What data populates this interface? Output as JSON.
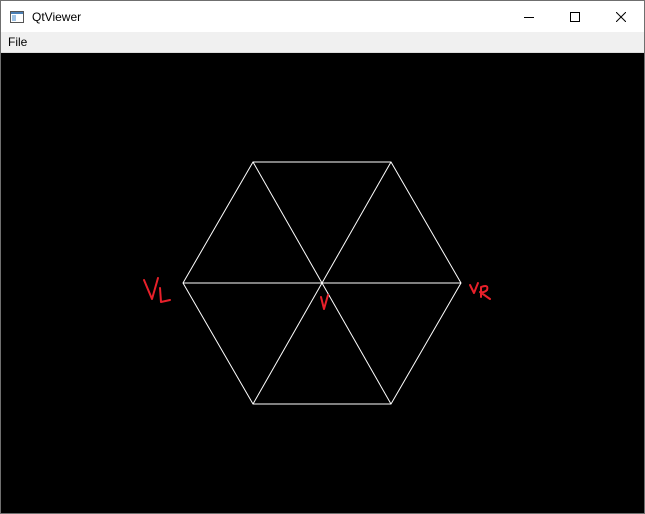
{
  "window": {
    "title": "QtViewer",
    "icon": "app-window-icon",
    "buttons": [
      "minimize-icon",
      "maximize-icon",
      "close-icon"
    ]
  },
  "menubar": {
    "items": [
      {
        "label": "File"
      }
    ]
  },
  "canvas": {
    "background": "#000000",
    "mesh_color": "#ffffff",
    "annotation_color": "#e8202a",
    "annotations": {
      "left_label": "VL",
      "center_label": "V",
      "right_label": "VR"
    }
  }
}
